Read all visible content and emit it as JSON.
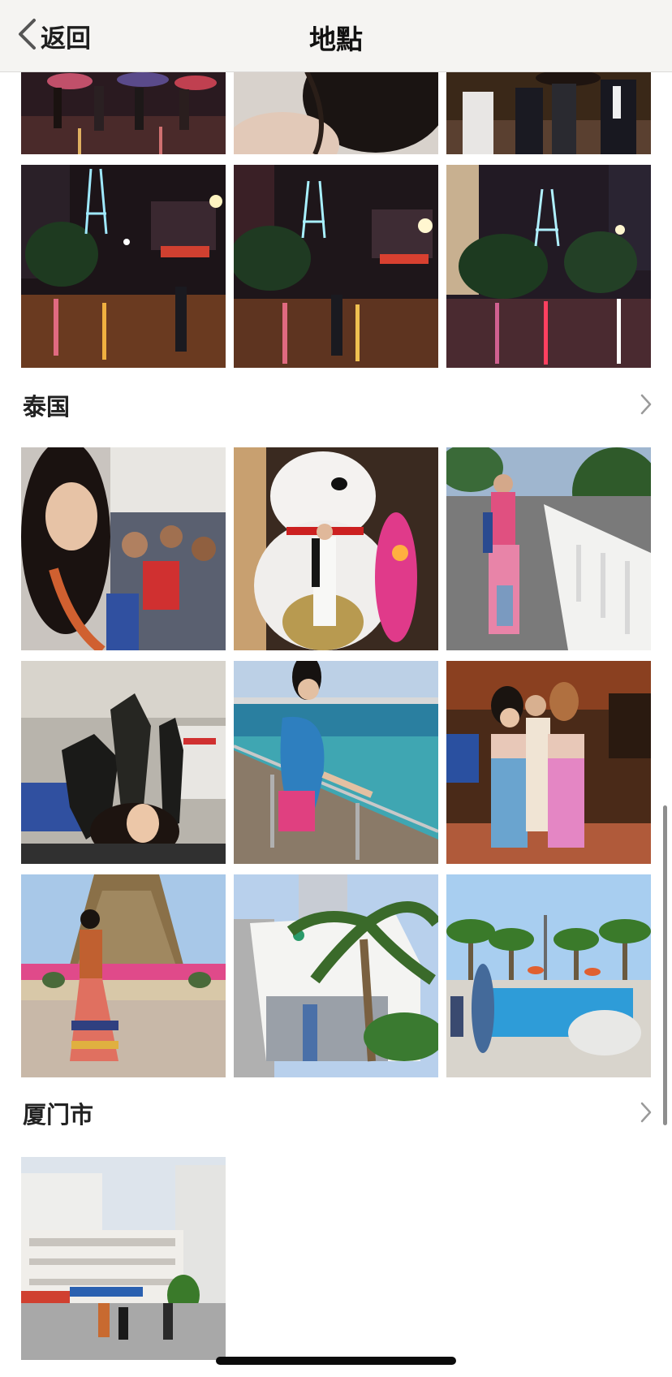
{
  "nav": {
    "back_label": "返回",
    "title": "地點"
  },
  "sections": [
    {
      "title": "泰国"
    },
    {
      "title": "厦门市"
    }
  ],
  "icons": {
    "back": "chevron-left-icon",
    "section_more": "chevron-right-icon"
  }
}
